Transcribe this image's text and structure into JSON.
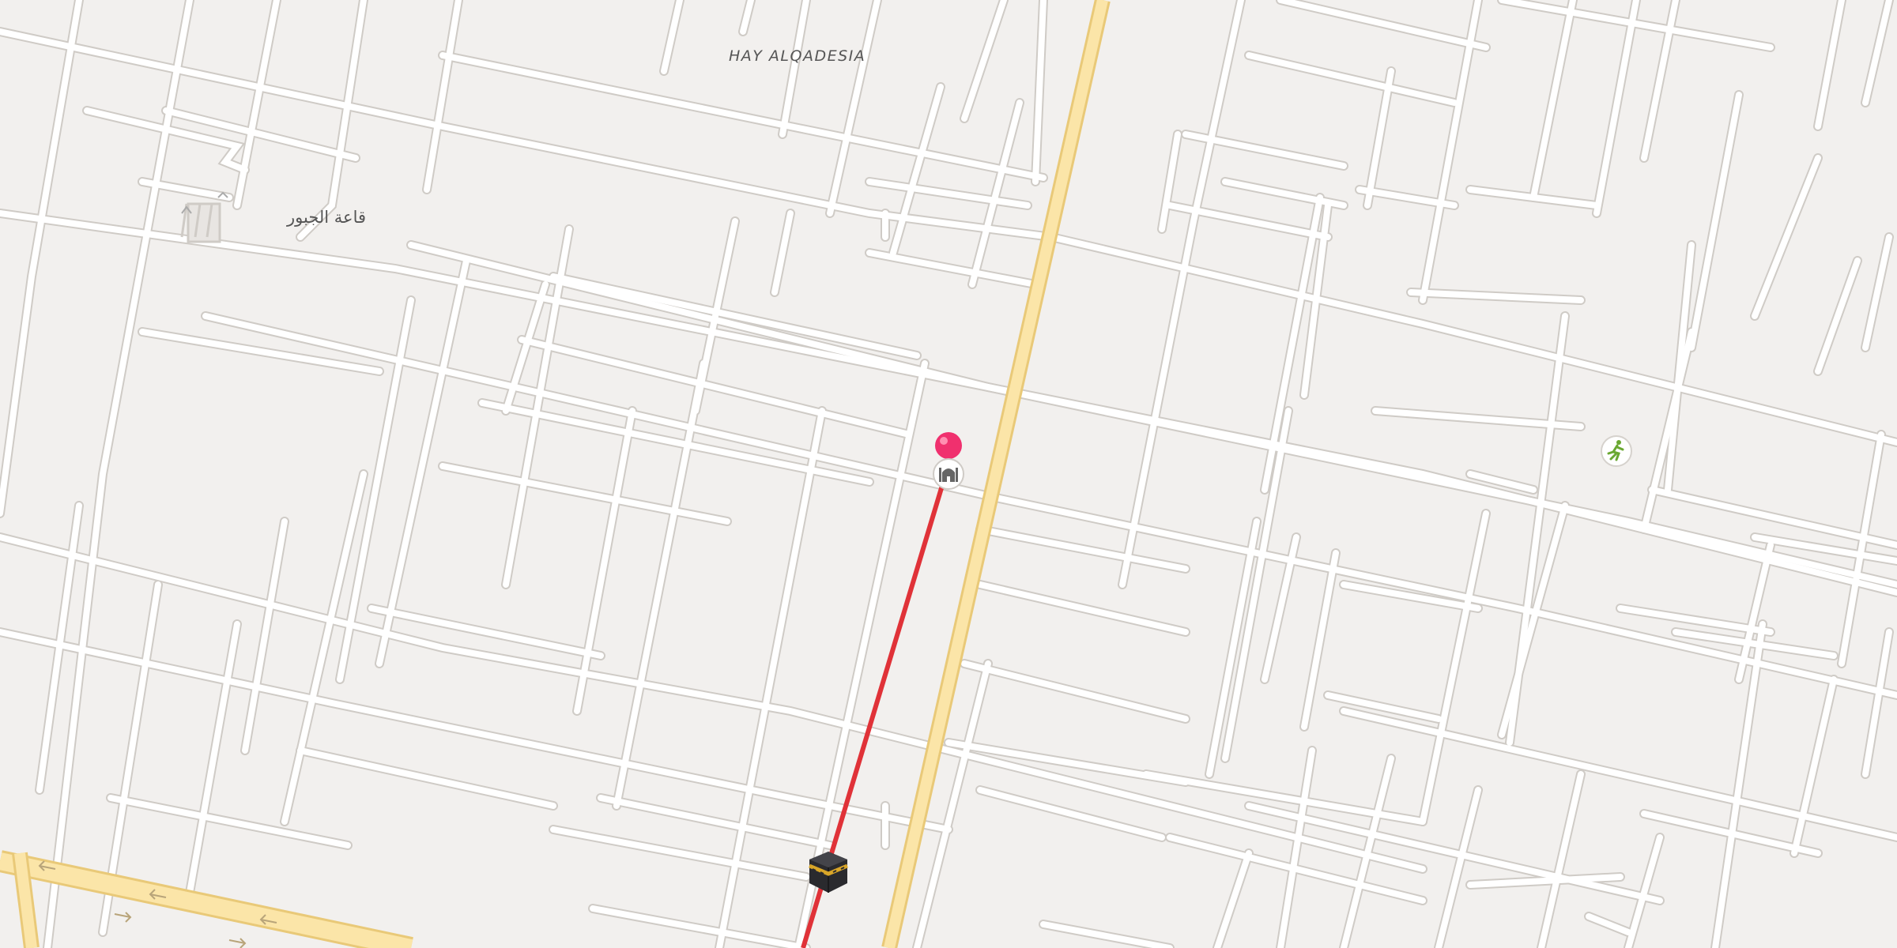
{
  "map": {
    "neighborhood_label": "HAY ALQADESIA",
    "place_label": "قاعة الجبور",
    "colors": {
      "background": "#f2f0ee",
      "block_fill": "#f5f3f1",
      "street_casing": "#cfcbc6",
      "street_fill": "#ffffff",
      "main_road_casing": "#e9c978",
      "main_road_fill": "#fbe5a8",
      "qibla_line": "#e03238",
      "pin": "#f0306e"
    },
    "icons": {
      "location_pin": "location-pin-icon",
      "mosque": "mosque-icon",
      "kaaba": "kaaba-icon",
      "sports": "running-figure-icon",
      "parking": "parking-icon"
    }
  }
}
